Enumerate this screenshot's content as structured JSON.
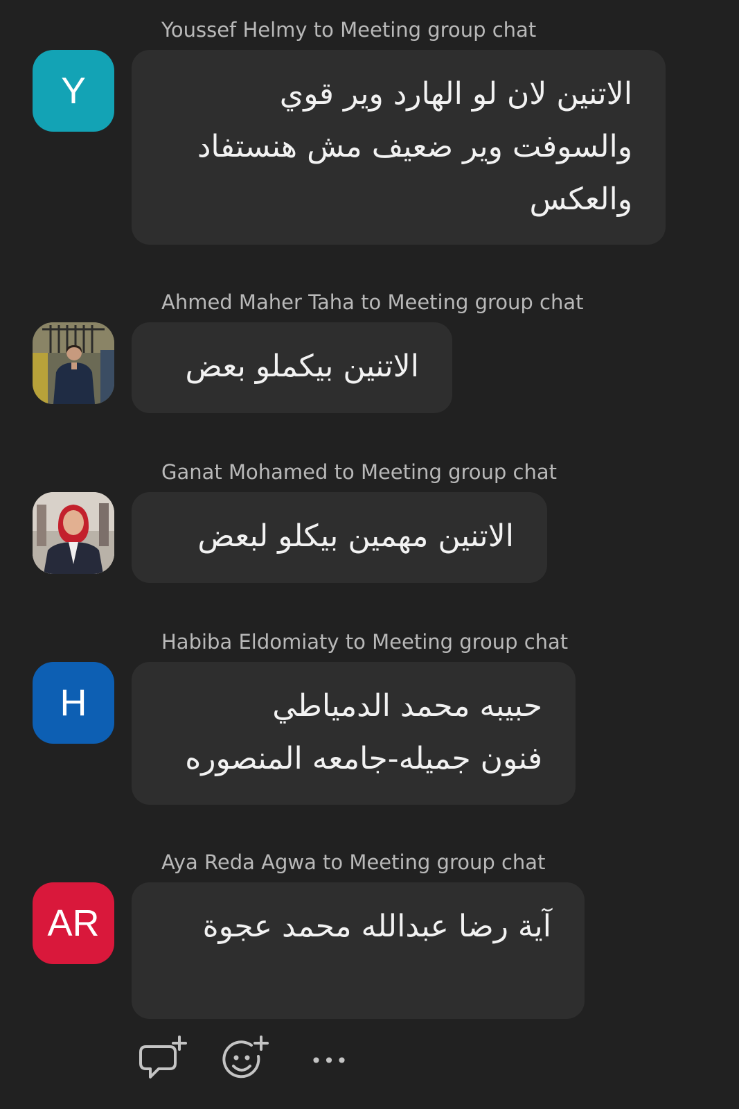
{
  "messages": [
    {
      "sender": "Youssef Helmy to Meeting group chat",
      "avatar_initials": "Y",
      "avatar_color": "#13a3b5",
      "text": "الاتنين لان لو الهارد وير قوي\nوالسوفت وير ضعيف مش هنستفاد\nوالعكس"
    },
    {
      "sender": "Ahmed Maher Taha to Meeting group chat",
      "avatar_initials": "",
      "avatar_color": "#5a5f52",
      "text": "الاتنين بيكملو بعض"
    },
    {
      "sender": "Ganat Mohamed to Meeting group chat",
      "avatar_initials": "",
      "avatar_color": "#c9c2ba",
      "text": "الاتنين مهمين بيكلو لبعض"
    },
    {
      "sender": "Habiba Eldomiaty to Meeting group chat",
      "avatar_initials": "H",
      "avatar_color": "#0d5fb3",
      "text": "حبيبه محمد الدمياطي\nفنون جميله-جامعه المنصوره"
    },
    {
      "sender": "Aya Reda Agwa to Meeting group chat",
      "avatar_initials": "AR",
      "avatar_color": "#d9183b",
      "text": "آية رضا عبدالله محمد عجوة"
    }
  ],
  "toolbar": {
    "reply_icon": "comment-add-icon",
    "react_icon": "emoji-add-icon",
    "more_label": "•••"
  }
}
